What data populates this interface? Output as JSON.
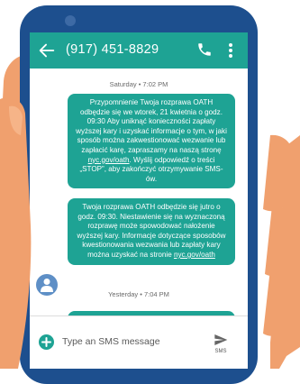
{
  "header": {
    "phone_number": "(917) 451-8829"
  },
  "messages": [
    {
      "timestamp": "Saturday • 7:02 PM",
      "text_before": "Przypomnienie Twoja rozprawa OATH odbędzie się we wtorek, 21 kwietnia o godz. 09:30 Aby uniknąć konieczności zapłaty wyższej kary i uzyskać informacje o tym, w jaki sposób można zakwestionować wezwanie lub zapłacić karę, zapraszamy na naszą stronę ",
      "link": "nyc.gov/oath",
      "text_after": ". Wyślij odpowiedź o treści „STOP”, aby zakończyć otrzymywanie SMS-ów."
    },
    {
      "text_before": "Twoja rozprawa OATH odbędzie się jutro o godz. 09:30. Niestawienie się na wyznaczoną rozprawę może spowodować nałożenie wyższej kary. Informacje dotyczące sposobów kwestionowania wezwania lub zapłaty kary można uzyskać na stronie ",
      "link": "nyc.gov/oath",
      "text_after": ""
    }
  ],
  "separator_2": "Yesterday • 7:04 PM",
  "composer": {
    "placeholder": "Type an SMS message",
    "send_label": "SMS"
  },
  "colors": {
    "accent": "#1ea394",
    "phone_body": "#1d4f8e",
    "skin": "#f0a06e"
  }
}
